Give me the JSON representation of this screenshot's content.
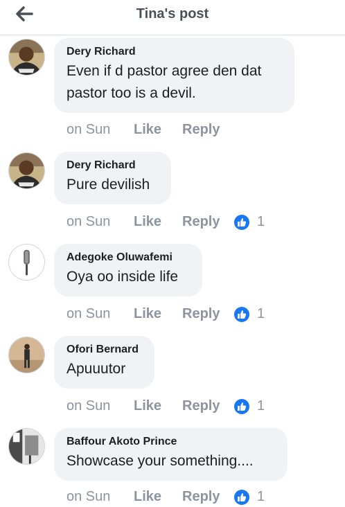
{
  "header": {
    "title": "Tina's post",
    "back_icon": "back-arrow-icon"
  },
  "colors": {
    "like_blue": "#1877f2",
    "bubble": "#f0f2f5",
    "muted": "#8d949e"
  },
  "comments": [
    {
      "author": "Dery Richard",
      "text_lines": [
        "Even if d pastor agree den dat",
        "pastor too is a devil."
      ],
      "time": "on Sun",
      "like": "Like",
      "reply": "Reply",
      "reactions": ""
    },
    {
      "author": "Dery Richard",
      "text_lines": [
        "Pure devilish"
      ],
      "time": "on Sun",
      "like": "Like",
      "reply": "Reply",
      "reactions": "1"
    },
    {
      "author": "Adegoke Oluwafemi",
      "text_lines": [
        "Oya oo inside life"
      ],
      "time": "on Sun",
      "like": "Like",
      "reply": "Reply",
      "reactions": "1"
    },
    {
      "author": "Ofori Bernard",
      "text_lines": [
        "Apuuutor"
      ],
      "time": "on Sun",
      "like": "Like",
      "reply": "Reply",
      "reactions": "1"
    },
    {
      "author": "Baffour Akoto Prince",
      "text_lines": [
        "Showcase your something...."
      ],
      "time": "on Sun",
      "like": "Like",
      "reply": "Reply",
      "reactions": "1"
    }
  ]
}
